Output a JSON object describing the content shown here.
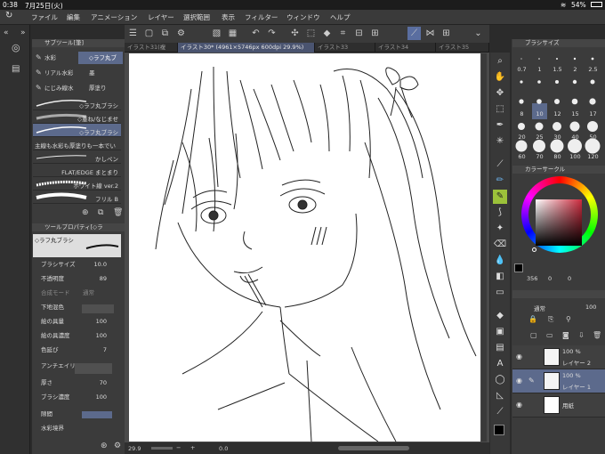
{
  "status": {
    "time": "0:38",
    "date": "7月25日(火)",
    "battery": "54%"
  },
  "menu": [
    "ファイル",
    "編集",
    "アニメーション",
    "レイヤー",
    "選択範囲",
    "表示",
    "フィルター",
    "ウィンドウ",
    "ヘルプ"
  ],
  "tabs": [
    "イラスト31(複",
    "イラスト30* (4961×5746px 600dpi 29.9%)",
    "イラスト33",
    "イラスト34",
    "イラスト35"
  ],
  "subtool": {
    "header": "サブツール[筆]",
    "tools": [
      {
        "label": "水彩",
        "active": false
      },
      {
        "label": "◇ラフ丸ブ",
        "active": true
      },
      {
        "label": "リアル水彩",
        "active": false
      },
      {
        "label": "墨",
        "active": false
      },
      {
        "label": "にじみ線水",
        "active": false
      },
      {
        "label": "厚塗り",
        "active": false
      }
    ],
    "brushes": [
      {
        "label": "◇ラフ丸ブラシ",
        "active": false
      },
      {
        "label": "◇重ね/なじませ",
        "active": false
      },
      {
        "label": "◇ラフ丸ブラシ",
        "active": true
      },
      {
        "label": "主線も水彩も厚塗りも一本でい",
        "active": false
      },
      {
        "label": "かしペン",
        "active": false
      },
      {
        "label": "FLAT/EDGE まとまり",
        "active": false
      },
      {
        "label": "ホワイト線 ver.2",
        "active": false
      },
      {
        "label": "フリル B",
        "active": false
      }
    ]
  },
  "toolprop": {
    "header": "ツールプロパティ[◇ラ",
    "brush_name": "◇ラフ丸ブラシ",
    "rows": [
      {
        "label": "ブラシサイズ",
        "value": "10.0"
      },
      {
        "label": "不透明度",
        "value": "89"
      },
      {
        "label": "合成モード",
        "value": "通常"
      },
      {
        "label": "下地混色",
        "value": ""
      },
      {
        "label": "絵の具量",
        "value": "100"
      },
      {
        "label": "絵の具濃度",
        "value": "100"
      },
      {
        "label": "色延び",
        "value": "7"
      },
      {
        "label": "アンチエイリ",
        "value": ""
      },
      {
        "label": "厚さ",
        "value": "70"
      },
      {
        "label": "ブラシ濃度",
        "value": "100"
      },
      {
        "label": "隙間",
        "value": ""
      },
      {
        "label": "水彩境界",
        "value": ""
      }
    ]
  },
  "brushsize": {
    "header": "ブラシサイズ",
    "row1": [
      "0.7",
      "1",
      "1.5",
      "2",
      "2.5"
    ],
    "row2": [
      "8",
      "10",
      "12",
      "15",
      "17"
    ],
    "row3": [
      "20",
      "25",
      "30",
      "40",
      "50"
    ],
    "row4": [
      "60",
      "70",
      "80",
      "100",
      "120"
    ],
    "selected": "10"
  },
  "colorcircle": {
    "header": "カラーサークル",
    "h": "356",
    "s": "0",
    "v": "0",
    "accent": "#cc2b3e"
  },
  "layers": {
    "blend": "通常",
    "opacity": "100",
    "items": [
      {
        "opacity": "100 %",
        "name": "レイヤー 2",
        "active": false
      },
      {
        "opacity": "100 %",
        "name": "レイヤー 1",
        "active": true
      },
      {
        "opacity": "",
        "name": "用紙",
        "active": false
      }
    ]
  },
  "bottom": {
    "zoom": "29.9",
    "angle": "0.0"
  }
}
